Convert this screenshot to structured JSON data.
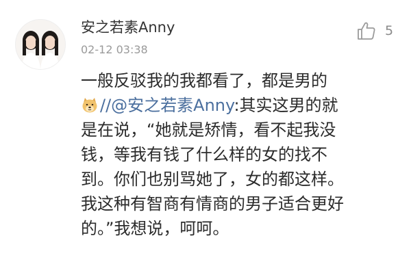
{
  "comment": {
    "username": "安之若素Anny",
    "timestamp": "02-12 03:38",
    "like": {
      "icon": "thumbs-up-icon",
      "count": "5"
    },
    "avatar": {
      "icon": "avatar-two-girls"
    },
    "body": {
      "line1": "一般反驳我的我都看了，都是男的",
      "emoji_icon": "doge-emoji-icon",
      "mention": "//@安之若素Anny",
      "line2_rest": ":其实这男的就",
      "line3": "是在说，“她就是矫情，看不起我没",
      "line4": "钱，等我有钱了什么样的女的找不",
      "line5": "到。你们也别骂她了，女的都这样。",
      "line6": "我这种有智商有情商的男子适合更好",
      "line7": "的。”我想说，呵呵。"
    },
    "colors": {
      "mention": "#4b6f9e",
      "timestamp": "#9a9a9a",
      "text": "#2b2b2b"
    }
  }
}
